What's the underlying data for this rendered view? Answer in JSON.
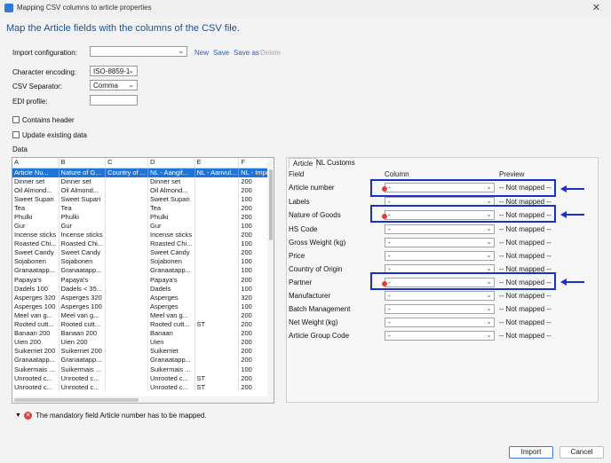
{
  "window": {
    "title": "Mapping CSV columns to article properties",
    "close": "✕"
  },
  "heading": "Map the Article fields with the columns of the CSV file.",
  "import_config": {
    "label": "Import configuration:",
    "value": "",
    "links": {
      "new": "New",
      "save": "Save",
      "save_as": "Save as",
      "delete": "Delete"
    }
  },
  "encoding": {
    "label": "Character encoding:",
    "value": "ISO-8859-1"
  },
  "separator": {
    "label": "CSV Separator:",
    "value": "Comma"
  },
  "edi": {
    "label": "EDI profile:",
    "value": ""
  },
  "contains_header": {
    "label": "Contains header",
    "checked": false
  },
  "update_existing": {
    "label": "Update existing data",
    "checked": false
  },
  "data_label": "Data",
  "grid": {
    "columns": [
      "A",
      "B",
      "C",
      "D",
      "E",
      "F"
    ],
    "rows": [
      [
        "Article Nu...",
        "Nature of G...",
        "Country of ...",
        "NL - Aangif...",
        "NL - Aanvul...",
        "NL - Import..."
      ],
      [
        "Dinner set",
        "Dinner set",
        "",
        "Dinner set",
        "",
        "200"
      ],
      [
        "Oil Almond...",
        "Oil Almond...",
        "",
        "Oil Almond...",
        "",
        "200"
      ],
      [
        "Sweet Supari",
        "Sweet Supari",
        "",
        "Sweet Supari",
        "",
        "100"
      ],
      [
        "Tea",
        "Tea",
        "",
        "Tea",
        "",
        "200"
      ],
      [
        "Phulki",
        "Phulki",
        "",
        "Phulki",
        "",
        "200"
      ],
      [
        "Gur",
        "Gur",
        "",
        "Gur",
        "",
        "100"
      ],
      [
        "Incense sticks",
        "Incense sticks",
        "",
        "Incense sticks",
        "",
        "200"
      ],
      [
        "Roasted Chi...",
        "Roasted Chi...",
        "",
        "Roasted Chi...",
        "",
        "100"
      ],
      [
        "Sweet Candy",
        "Sweet Candy",
        "",
        "Sweet Candy",
        "",
        "200"
      ],
      [
        "Sojabonen",
        "Sojabonen",
        "",
        "Sojabonen",
        "",
        "100"
      ],
      [
        "Granaatapp...",
        "Granaatapp...",
        "",
        "Granaatapp...",
        "",
        "100"
      ],
      [
        "Papaya's",
        "Papaya's",
        "",
        "Papaya's",
        "",
        "200"
      ],
      [
        "Dadels 100",
        "Dadels < 35...",
        "",
        "Dadels",
        "",
        "100"
      ],
      [
        "Asperges 320",
        "Asperges 320",
        "",
        "Asperges",
        "",
        "320"
      ],
      [
        "Asperges 100",
        "Asperges 100",
        "",
        "Asperges",
        "",
        "100"
      ],
      [
        "Meel van g...",
        "Meel van g...",
        "",
        "Meel van g...",
        "",
        "200"
      ],
      [
        "Rooted cutt...",
        "Rooted cutt...",
        "",
        "Rooted cutt...",
        "ST",
        "200"
      ],
      [
        "Banaan 200",
        "Banaan 200",
        "",
        "Banaan",
        "",
        "200"
      ],
      [
        "Uien 200",
        "Uien 200",
        "",
        "Uien",
        "",
        "200"
      ],
      [
        "Suikerriet 200",
        "Suikerriet 200",
        "",
        "Suikerriet",
        "",
        "200"
      ],
      [
        "Granaatapp...",
        "Granaatapp...",
        "",
        "Granaatapp...",
        "",
        "200"
      ],
      [
        "Suikermais ...",
        "Suikermais ...",
        "",
        "Suikermais ...",
        "",
        "100"
      ],
      [
        "Unrooted c...",
        "Unrooted c...",
        "",
        "Unrooted c...",
        "ST",
        "200"
      ],
      [
        "Unrooted c...",
        "Unrooted c...",
        "",
        "Unrooted c...",
        "ST",
        "200"
      ]
    ]
  },
  "tabs": [
    "Article",
    "NL Customs"
  ],
  "mapping": {
    "headers": {
      "field": "Field",
      "column": "Column",
      "preview": "Preview"
    },
    "rows": [
      {
        "field": "Article number",
        "column": "-",
        "preview": "-- Not mapped --",
        "error": true
      },
      {
        "field": "Labels",
        "column": "-",
        "preview": "-- Not mapped --",
        "error": false
      },
      {
        "field": "Nature of Goods",
        "column": "-",
        "preview": "-- Not mapped --",
        "error": true
      },
      {
        "field": "HS Code",
        "column": "-",
        "preview": "-- Not mapped --",
        "error": false
      },
      {
        "field": "Gross Weight (kg)",
        "column": "-",
        "preview": "-- Not mapped --",
        "error": false
      },
      {
        "field": "Price",
        "column": "-",
        "preview": "-- Not mapped --",
        "error": false
      },
      {
        "field": "Country of Origin",
        "column": "-",
        "preview": "-- Not mapped --",
        "error": false
      },
      {
        "field": "Partner",
        "column": "-",
        "preview": "-- Not mapped --",
        "error": true
      },
      {
        "field": "Manufacturer",
        "column": "-",
        "preview": "-- Not mapped --",
        "error": false
      },
      {
        "field": "Batch Management",
        "column": "-",
        "preview": "-- Not mapped --",
        "error": false
      },
      {
        "field": "Net Weight (kg)",
        "column": "-",
        "preview": "-- Not mapped --",
        "error": false
      },
      {
        "field": "Article Group Code",
        "column": "-",
        "preview": "-- Not mapped --",
        "error": false
      }
    ]
  },
  "status": {
    "message": "The mandatory field Article number has to be mapped.",
    "icon": "error-icon",
    "expand_glyph": "▼",
    "error_glyph": "✕"
  },
  "buttons": {
    "import": "Import",
    "cancel": "Cancel"
  },
  "colors": {
    "heading": "#1c4f9c",
    "selection": "#1f74d8",
    "annotation": "#1b2fcf",
    "error": "#e23b3b"
  }
}
